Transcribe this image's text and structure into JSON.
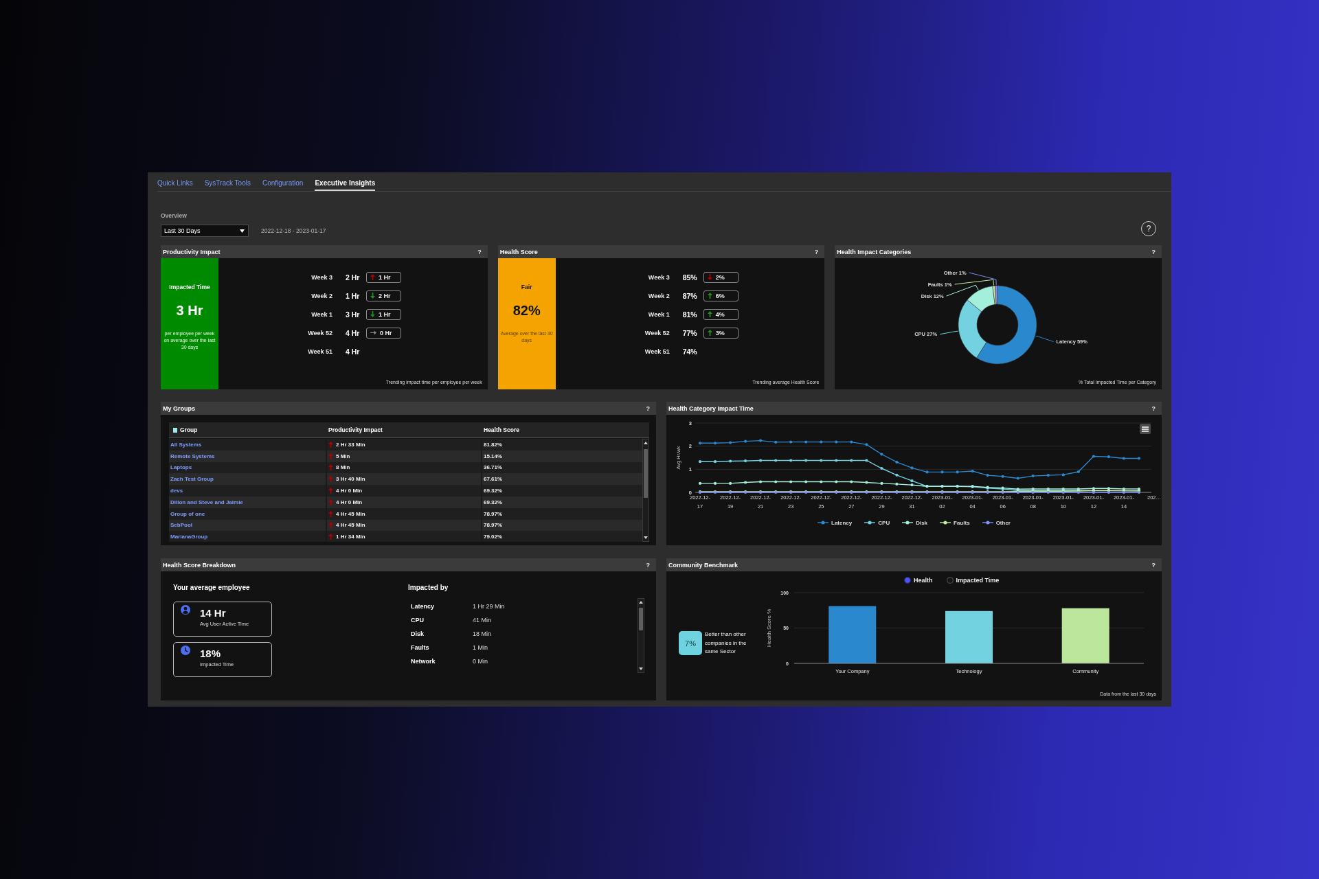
{
  "tabs": [
    {
      "label": "Quick Links",
      "selected": false
    },
    {
      "label": "SysTrack Tools",
      "selected": false
    },
    {
      "label": "Configuration",
      "selected": false
    },
    {
      "label": "Executive Insights",
      "selected": true
    }
  ],
  "overview": {
    "title": "Overview",
    "range": {
      "value": "Last 30 Days"
    },
    "date_range": "2022-12-18 - 2023-01-17",
    "help": "?"
  },
  "productivity_impact": {
    "title": "Productivity Impact",
    "help": "?",
    "summary": {
      "kind": "good",
      "heading": "Impacted Time",
      "value": "3 Hr",
      "caption": "per employee per week on average over the last 30 days"
    },
    "weeks": [
      {
        "label": "Week 3",
        "value": "2 Hr",
        "change": {
          "kind": "up",
          "color": "#b00000",
          "value": "1 Hr"
        }
      },
      {
        "label": "Week 2",
        "value": "1 Hr",
        "change": {
          "kind": "down",
          "color": "#1f8f1f",
          "value": "2 Hr"
        }
      },
      {
        "label": "Week 1",
        "value": "3 Hr",
        "change": {
          "kind": "down",
          "color": "#1f8f1f",
          "value": "1 Hr"
        }
      },
      {
        "label": "Week 52",
        "value": "4 Hr",
        "change": {
          "kind": "flat",
          "color": "#8a8a8a",
          "value": "0 Hr"
        }
      },
      {
        "label": "Week 51",
        "value": "4 Hr"
      }
    ],
    "footnote": "Trending impact time per employee per week"
  },
  "health_score": {
    "title": "Health Score",
    "help": "?",
    "summary": {
      "kind": "fair",
      "heading": "Fair",
      "value": "82%",
      "caption": "Average over the last 30 days"
    },
    "weeks": [
      {
        "label": "Week 3",
        "value": "85%",
        "change": {
          "kind": "down",
          "color": "#b00000",
          "value": "2%"
        }
      },
      {
        "label": "Week 2",
        "value": "87%",
        "change": {
          "kind": "up",
          "color": "#1f8f1f",
          "value": "6%"
        }
      },
      {
        "label": "Week 1",
        "value": "81%",
        "change": {
          "kind": "up",
          "color": "#1f8f1f",
          "value": "4%"
        }
      },
      {
        "label": "Week 52",
        "value": "77%",
        "change": {
          "kind": "up",
          "color": "#1f8f1f",
          "value": "3%"
        }
      },
      {
        "label": "Week 51",
        "value": "74%"
      }
    ],
    "footnote": "Trending average Health Score"
  },
  "health_impact_categories": {
    "title": "Health Impact Categories",
    "help": "?",
    "chart_data": {
      "type": "donut",
      "categories": [
        "Latency",
        "CPU",
        "Disk",
        "Faults",
        "Other"
      ],
      "values": [
        59,
        27,
        12,
        1,
        1
      ],
      "colors": [
        "#2a88cf",
        "#72d2df",
        "#a3efdc",
        "#c6eba3",
        "#7f90f2"
      ],
      "value_labels": [
        "59%",
        "27%",
        "12%",
        "1%",
        "1%"
      ]
    },
    "footnote": "% Total Impacted Time per Category"
  },
  "my_groups": {
    "title": "My Groups",
    "help": "?",
    "table": {
      "columns": [
        "Group",
        "Productivity Impact",
        "Health Score"
      ],
      "rows": [
        {
          "group": "All Systems",
          "productivity_impact": "2 Hr 33 Min",
          "trend": {
            "kind": "up",
            "color": "#b00000"
          },
          "health_score": "81.82%"
        },
        {
          "group": "Remote Systems",
          "productivity_impact": "5 Min",
          "trend": {
            "kind": "up",
            "color": "#b00000"
          },
          "health_score": "15.14%"
        },
        {
          "group": "Laptops",
          "productivity_impact": "8 Min",
          "trend": {
            "kind": "up",
            "color": "#b00000"
          },
          "health_score": "36.71%"
        },
        {
          "group": "Zach Test Group",
          "productivity_impact": "3 Hr 40 Min",
          "trend": {
            "kind": "up",
            "color": "#b00000"
          },
          "health_score": "67.61%"
        },
        {
          "group": "devs",
          "productivity_impact": "4 Hr 0 Min",
          "trend": {
            "kind": "up",
            "color": "#b00000"
          },
          "health_score": "69.32%"
        },
        {
          "group": "Dillon and Steve and Jaimie",
          "productivity_impact": "4 Hr 0 Min",
          "trend": {
            "kind": "up",
            "color": "#b00000"
          },
          "health_score": "69.32%"
        },
        {
          "group": "Group of one",
          "productivity_impact": "4 Hr 45 Min",
          "trend": {
            "kind": "up",
            "color": "#b00000"
          },
          "health_score": "78.97%"
        },
        {
          "group": "SebPool",
          "productivity_impact": "4 Hr 45 Min",
          "trend": {
            "kind": "up",
            "color": "#b00000"
          },
          "health_score": "78.97%"
        },
        {
          "group": "MarianaGroup",
          "productivity_impact": "1 Hr 34 Min",
          "trend": {
            "kind": "up",
            "color": "#b00000"
          },
          "health_score": "79.02%"
        }
      ]
    }
  },
  "health_category_impact_time": {
    "title": "Health Category Impact Time",
    "help": "?",
    "chart_data": {
      "type": "line",
      "ylabel": "Avg Hr/wk",
      "categories": [
        "2022-12-17",
        null,
        "2022-12-19",
        null,
        "2022-12-21",
        null,
        "2022-12-23",
        null,
        "2022-12-25",
        null,
        "2022-12-27",
        null,
        "2022-12-29",
        null,
        "2022-12-31",
        null,
        "2023-01-02",
        null,
        "2023-01-04",
        null,
        "2023-01-06",
        null,
        "2023-01-08",
        null,
        "2023-01-10",
        null,
        "2023-01-12",
        null,
        "2023-01-14",
        null,
        "202…"
      ],
      "series": [
        {
          "name": "Latency",
          "color": "#2a88cf",
          "values": [
            2.13,
            2.13,
            2.15,
            2.21,
            2.24,
            2.17,
            2.18,
            2.18,
            2.18,
            2.18,
            2.18,
            2.07,
            1.65,
            1.31,
            1.06,
            0.88,
            0.88,
            0.88,
            0.92,
            0.74,
            0.69,
            0.61,
            0.71,
            0.74,
            0.76,
            0.89,
            1.56,
            1.54,
            1.47,
            1.47,
            null
          ]
        },
        {
          "name": "CPU",
          "color": "#72d2df",
          "values": [
            1.33,
            1.33,
            1.35,
            1.36,
            1.38,
            1.38,
            1.38,
            1.38,
            1.38,
            1.38,
            1.38,
            1.38,
            1.04,
            0.75,
            0.5,
            0.26,
            0.26,
            0.26,
            0.24,
            0.18,
            0.15,
            0.08,
            0.08,
            0.08,
            0.08,
            0.08,
            0.07,
            0.07,
            0.07,
            0.06,
            null
          ]
        },
        {
          "name": "Disk",
          "color": "#a3efdc",
          "values": [
            0.39,
            0.39,
            0.39,
            0.43,
            0.46,
            0.46,
            0.46,
            0.46,
            0.46,
            0.46,
            0.46,
            0.43,
            0.39,
            0.36,
            0.32,
            0.26,
            0.26,
            0.26,
            0.26,
            0.22,
            0.19,
            0.14,
            0.15,
            0.15,
            0.15,
            0.15,
            0.17,
            0.17,
            0.15,
            0.15,
            null
          ]
        },
        {
          "name": "Faults",
          "color": "#c6eba3",
          "values": [
            0.03,
            0.03,
            0.03,
            0.03,
            0.03,
            0.03,
            0.03,
            0.03,
            0.03,
            0.03,
            0.03,
            0.03,
            0.03,
            0.03,
            0.03,
            0.03,
            0.03,
            0.03,
            0.03,
            0.03,
            0.03,
            0.04,
            0.05,
            0.05,
            0.05,
            0.06,
            0.08,
            0.08,
            0.07,
            0.07,
            null
          ]
        },
        {
          "name": "Other",
          "color": "#7f90f2",
          "values": [
            0,
            0,
            0,
            0,
            0,
            0,
            0,
            0,
            0,
            0,
            0,
            0,
            0,
            0,
            0,
            0,
            0,
            0,
            0,
            0,
            0,
            0,
            0,
            0,
            0,
            0,
            0,
            0,
            0,
            0,
            null
          ]
        }
      ],
      "ylim": [
        0,
        3
      ],
      "yticks": [
        0,
        1,
        2,
        3
      ]
    }
  },
  "health_score_breakdown": {
    "title": "Health Score Breakdown",
    "help": "?",
    "employee": {
      "heading": "Your average employee",
      "stats": [
        {
          "kind": "user",
          "value": "14 Hr",
          "label": "Avg User Active Time"
        },
        {
          "kind": "clock",
          "value": "18%",
          "label": "Impacted Time"
        }
      ]
    },
    "impacted_by": {
      "heading": "Impacted by",
      "items": [
        {
          "label": "Latency",
          "value": "1 Hr 29 Min"
        },
        {
          "label": "CPU",
          "value": "41 Min"
        },
        {
          "label": "Disk",
          "value": "18 Min"
        },
        {
          "label": "Faults",
          "value": "1 Min"
        },
        {
          "label": "Network",
          "value": "0 Min"
        }
      ]
    }
  },
  "community_benchmark": {
    "title": "Community Benchmark",
    "help": "?",
    "toggle": [
      {
        "label": "Health",
        "selected": true
      },
      {
        "label": "Impacted Time",
        "selected": false
      }
    ],
    "comparison": {
      "value": "7%",
      "caption": "Better than other companies in the same Sector"
    },
    "chart_data": {
      "type": "bar",
      "ylabel": "Health Score %",
      "categories": [
        "Your Company",
        "Technology",
        "Community"
      ],
      "values": [
        81,
        74,
        78
      ],
      "colors": [
        "#2a88cf",
        "#72d2df",
        "#bde69d"
      ],
      "ylim": [
        0,
        100
      ],
      "yticks": [
        0,
        50,
        100
      ]
    },
    "footnote": "Data from the last 30 days"
  }
}
